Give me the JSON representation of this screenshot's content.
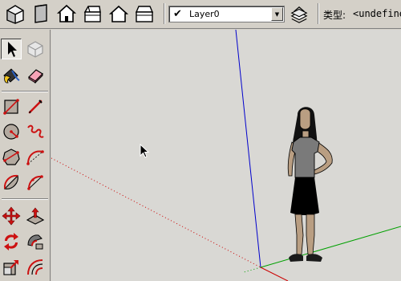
{
  "toolbar": {
    "views": [
      {
        "icon": "iso-view-icon"
      },
      {
        "icon": "top-view-icon"
      },
      {
        "icon": "front-view-icon"
      },
      {
        "icon": "right-view-icon"
      },
      {
        "icon": "back-view-icon"
      },
      {
        "icon": "left-view-icon"
      }
    ]
  },
  "layers": {
    "check": "✔",
    "current": "Layer0",
    "dropdown_icon": "chevron-down-icon"
  },
  "entity_info": {
    "type_label": "类型:",
    "type_value": "<undefined"
  },
  "tools": [
    "select-arrow-icon",
    "make-component-icon",
    "paint-bucket-icon",
    "eraser-icon",
    "rectangle-icon",
    "pencil-line-icon",
    "circle-icon",
    "freehand-icon",
    "polygon-icon",
    "arc-icon",
    "pie-icon",
    "arc-3pt-icon",
    "move-icon",
    "push-pull-icon",
    "rotate-icon",
    "follow-me-icon",
    "scale-icon",
    "offset-icon"
  ],
  "colors": {
    "toolbar_bg": "#d4d0c8",
    "viewport_bg": "#d9d8d4",
    "axis_red": "#cc0000",
    "axis_green": "#00a000",
    "axis_blue": "#0000cc",
    "tool_red": "#cc1111"
  }
}
